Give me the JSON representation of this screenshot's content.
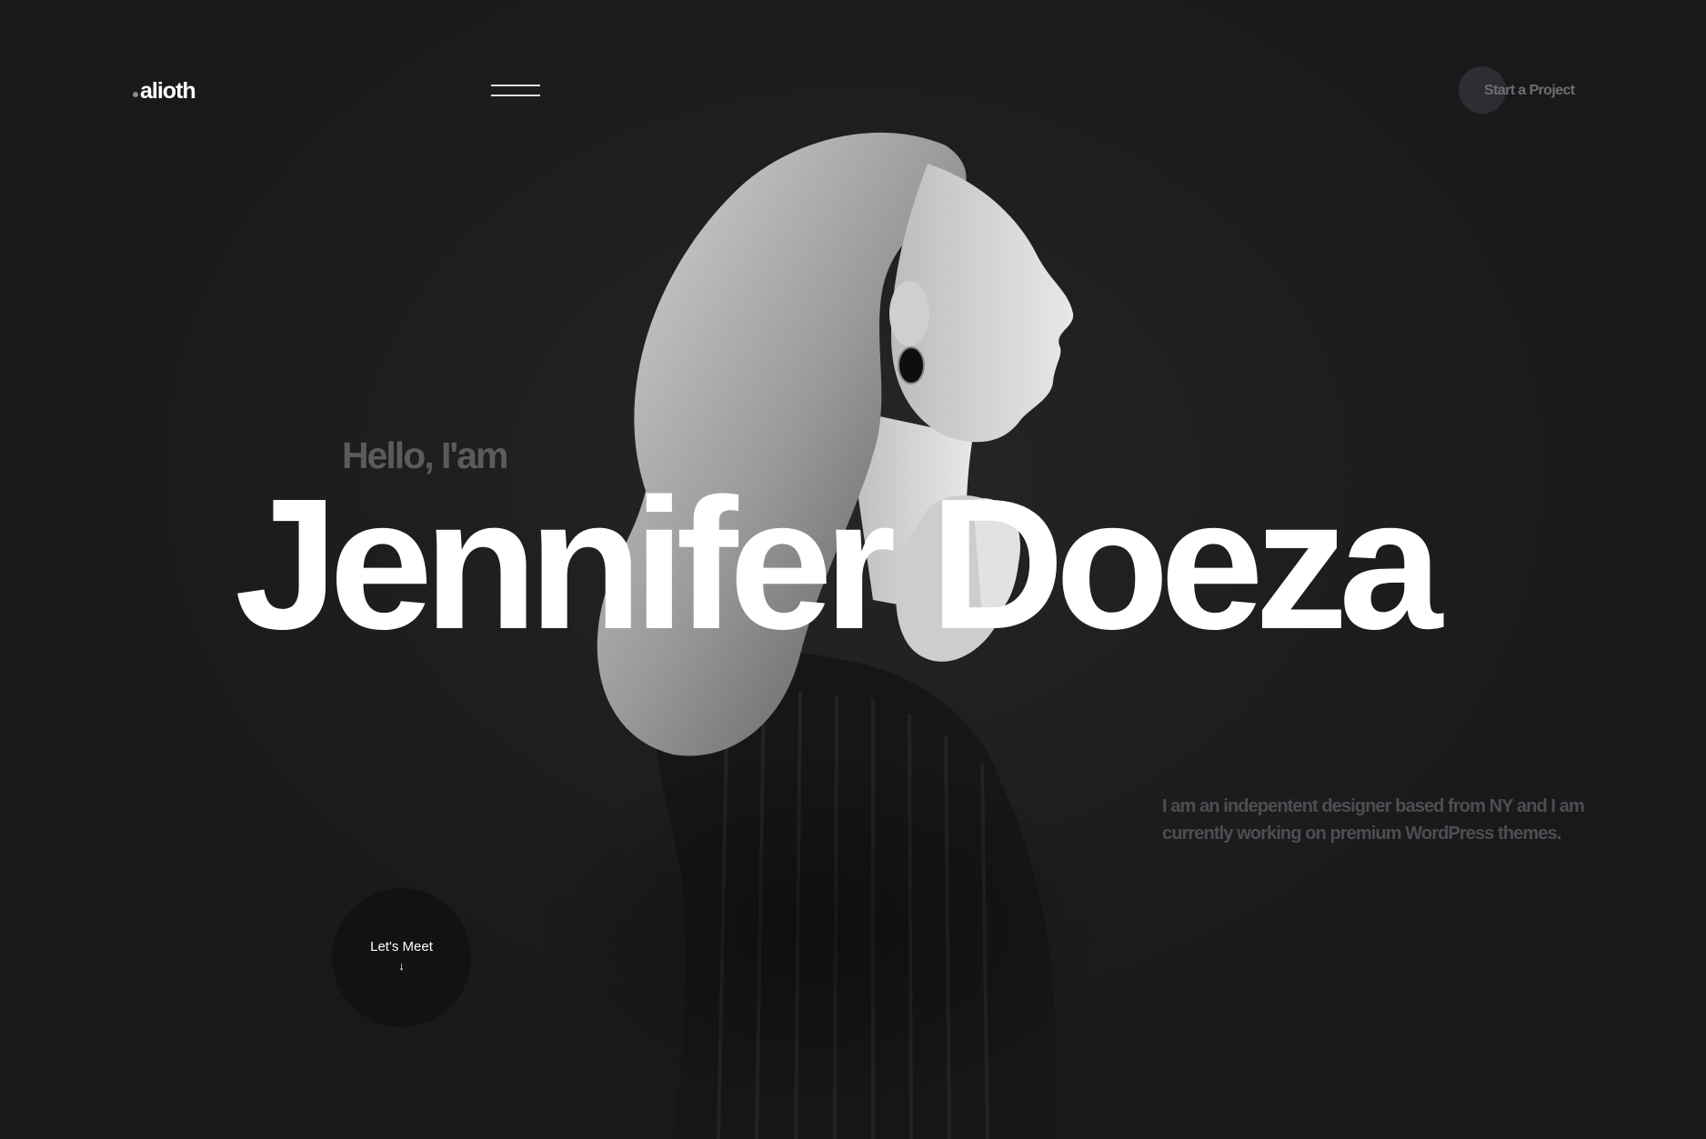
{
  "header": {
    "logo_text": "alioth",
    "menu_icon": "hamburger-icon",
    "cta_label": "Start a Project"
  },
  "hero": {
    "greeting": "Hello, I'am",
    "name": "Jennifer Doeza",
    "bio": "I am an indepentent designer based from NY and I am currently working on premium WordPress themes.",
    "meet_label": "Let's Meet",
    "meet_arrow": "↓",
    "meet_icon": "arrow-down-icon"
  },
  "colors": {
    "background": "#1c1c1e",
    "text_primary": "#ffffff",
    "text_muted": "#5b5b5e"
  }
}
